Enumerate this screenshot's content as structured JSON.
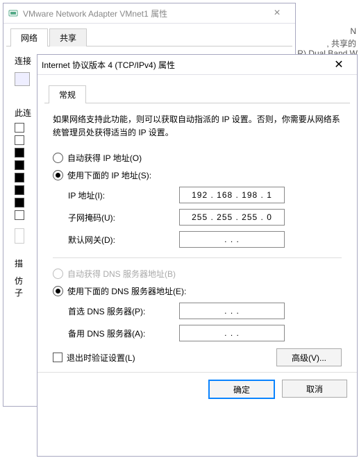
{
  "bg": {
    "line1": "N",
    "line2": ", 共享的",
    "line3": "R) Dual Band W"
  },
  "outer": {
    "title": "VMware Network Adapter VMnet1 属性",
    "tab_network": "网络",
    "tab_share": "共享",
    "label_connect": "连接",
    "label_thisconn": "此连",
    "label_desc": "描",
    "label_f1": "仿",
    "label_f2": "子"
  },
  "dlg": {
    "title": "Internet 协议版本 4 (TCP/IPv4) 属性",
    "tab_general": "常规",
    "intro": "如果网络支持此功能，则可以获取自动指派的 IP 设置。否则，你需要从网络系统管理员处获得适当的 IP 设置。",
    "ip_auto": "自动获得 IP 地址(O)",
    "ip_manual": "使用下面的 IP 地址(S):",
    "ip_addr_lbl": "IP 地址(I):",
    "ip_addr_val": "192 . 168 . 198 .   1",
    "subnet_lbl": "子网掩码(U):",
    "subnet_val": "255 . 255 . 255 .   0",
    "gateway_lbl": "默认网关(D):",
    "gateway_val": ".         .         .",
    "dns_auto": "自动获得 DNS 服务器地址(B)",
    "dns_manual": "使用下面的 DNS 服务器地址(E):",
    "dns1_lbl": "首选 DNS 服务器(P):",
    "dns1_val": ".         .         .",
    "dns2_lbl": "备用 DNS 服务器(A):",
    "dns2_val": ".         .         .",
    "validate": "退出时验证设置(L)",
    "advanced": "高级(V)...",
    "ok": "确定",
    "cancel": "取消"
  }
}
